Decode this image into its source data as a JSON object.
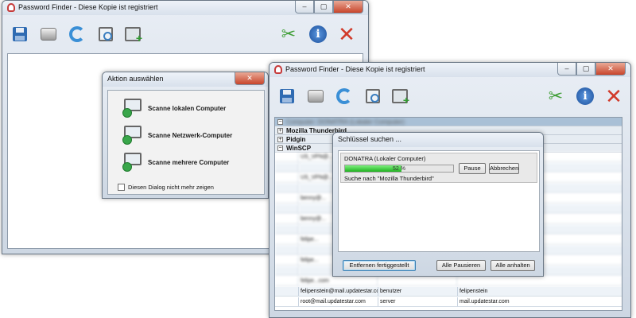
{
  "back_window": {
    "title": "Password Finder - Diese Kopie ist registriert"
  },
  "front_window": {
    "title": "Password Finder - Diese Kopie ist registriert"
  },
  "toolbar_icons": [
    "floppy-icon",
    "printer-icon",
    "refresh-icon",
    "magnifier-icon",
    "add-computer-icon",
    "tools-icon",
    "info-icon",
    "close-x-icon"
  ],
  "action_dialog": {
    "title": "Aktion auswählen",
    "items": [
      {
        "label": "Scanne lokalen Computer"
      },
      {
        "label": "Scanne Netzwerk-Computer"
      },
      {
        "label": "Scanne mehrere Computer"
      }
    ],
    "checkbox_label": "Diesen Dialog nicht mehr zeigen"
  },
  "tree": {
    "header": "Computer: DONATRA (Lokaler Computer)",
    "nodes": [
      {
        "sign": "+",
        "label": "Mozilla Thunderbird"
      },
      {
        "sign": "+",
        "label": "Pidgin"
      },
      {
        "sign": "−",
        "label": "WinSCP"
      }
    ]
  },
  "grid_rows": [
    [
      "",
      "US_VPN@...",
      "",
      ""
    ],
    [
      "",
      "",
      "",
      ""
    ],
    [
      "",
      "US_VPN@...",
      "",
      ""
    ],
    [
      "",
      "",
      "",
      ""
    ],
    [
      "",
      "benny@...",
      "",
      ""
    ],
    [
      "",
      "",
      "",
      ""
    ],
    [
      "",
      "benny@...",
      "",
      ""
    ],
    [
      "",
      "",
      "",
      ""
    ],
    [
      "",
      "felipe...",
      "",
      ""
    ],
    [
      "",
      "",
      "",
      ""
    ],
    [
      "",
      "felipe...",
      "",
      ""
    ],
    [
      "",
      "",
      "",
      ""
    ],
    [
      "",
      "felipe...com",
      "",
      ""
    ],
    [
      "",
      "felipenstein@mail.updatestar.com",
      "benutzer",
      "felipenstein"
    ],
    [
      "",
      "root@mail.updatestar.com",
      "server",
      "mail.updatestar.com"
    ]
  ],
  "search_dialog": {
    "title": "Schlüssel suchen ...",
    "computer_label": "DONATRA (Lokaler Computer)",
    "progress_text": "52 %",
    "progress": 0.52,
    "pause_label": "Pause",
    "abort_label": "Abbrechen",
    "status": "Suche nach \"Mozilla Thunderbird\"",
    "remove_done_label": "Entfernen fertiggestellt",
    "pause_all_label": "Alle Pausieren",
    "stop_all_label": "Alle anhalten"
  }
}
